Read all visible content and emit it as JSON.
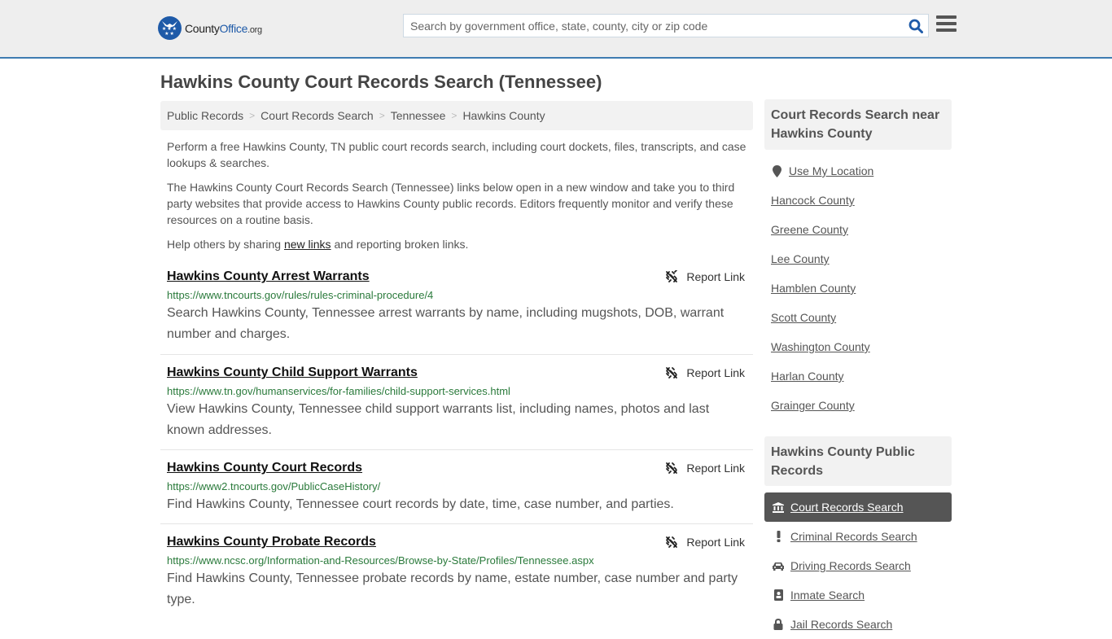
{
  "header": {
    "logo": {
      "county": "County",
      "office": "Office",
      "org": ".org",
      "stars": "★★★ ★★"
    },
    "search": {
      "placeholder": "Search by government office, state, county, city or zip code",
      "value": ""
    }
  },
  "page": {
    "title": "Hawkins County Court Records Search (Tennessee)"
  },
  "breadcrumb": [
    {
      "label": "Public Records"
    },
    {
      "label": "Court Records Search"
    },
    {
      "label": "Tennessee"
    },
    {
      "label": "Hawkins County"
    }
  ],
  "breadcrumb_separator": ">",
  "intro": {
    "p1": "Perform a free Hawkins County, TN public court records search, including court dockets, files, transcripts, and case lookups & searches.",
    "p2": "The Hawkins County Court Records Search (Tennessee) links below open in a new window and take you to third party websites that provide access to Hawkins County public records. Editors frequently monitor and verify these resources on a routine basis.",
    "p3_before": "Help others by sharing ",
    "p3_link": "new links",
    "p3_after": " and reporting broken links."
  },
  "report_label": "Report Link",
  "results": [
    {
      "title": "Hawkins County Arrest Warrants",
      "url": "https://www.tncourts.gov/rules/rules-criminal-procedure/4",
      "desc": "Search Hawkins County, Tennessee arrest warrants by name, including mugshots, DOB, warrant number and charges."
    },
    {
      "title": "Hawkins County Child Support Warrants",
      "url": "https://www.tn.gov/humanservices/for-families/child-support-services.html",
      "desc": "View Hawkins County, Tennessee child support warrants list, including names, photos and last known addresses."
    },
    {
      "title": "Hawkins County Court Records",
      "url": "https://www2.tncourts.gov/PublicCaseHistory/",
      "desc": "Find Hawkins County, Tennessee court records by date, time, case number, and parties."
    },
    {
      "title": "Hawkins County Probate Records",
      "url": "https://www.ncsc.org/Information-and-Resources/Browse-by-State/Profiles/Tennessee.aspx",
      "desc": "Find Hawkins County, Tennessee probate records by name, estate number, case number and party type."
    }
  ],
  "sidebar_nearby": {
    "heading": "Court Records Search near Hawkins County",
    "use_location": "Use My Location",
    "counties": [
      "Hancock County",
      "Greene County",
      "Lee County",
      "Hamblen County",
      "Scott County",
      "Washington County",
      "Harlan County",
      "Grainger County"
    ]
  },
  "sidebar_public": {
    "heading": "Hawkins County Public Records",
    "items": [
      {
        "label": "Court Records Search",
        "icon": "courthouse-icon",
        "active": true
      },
      {
        "label": "Criminal Records Search",
        "icon": "exclamation-icon",
        "active": false
      },
      {
        "label": "Driving Records Search",
        "icon": "car-icon",
        "active": false
      },
      {
        "label": "Inmate Search",
        "icon": "id-badge-icon",
        "active": false
      },
      {
        "label": "Jail Records Search",
        "icon": "lock-icon",
        "active": false
      }
    ]
  },
  "colors": {
    "brand_blue": "#1e5aa8",
    "header_border": "#3e7bb1",
    "url_green": "#2a7a3b",
    "active_bg": "#555555"
  }
}
